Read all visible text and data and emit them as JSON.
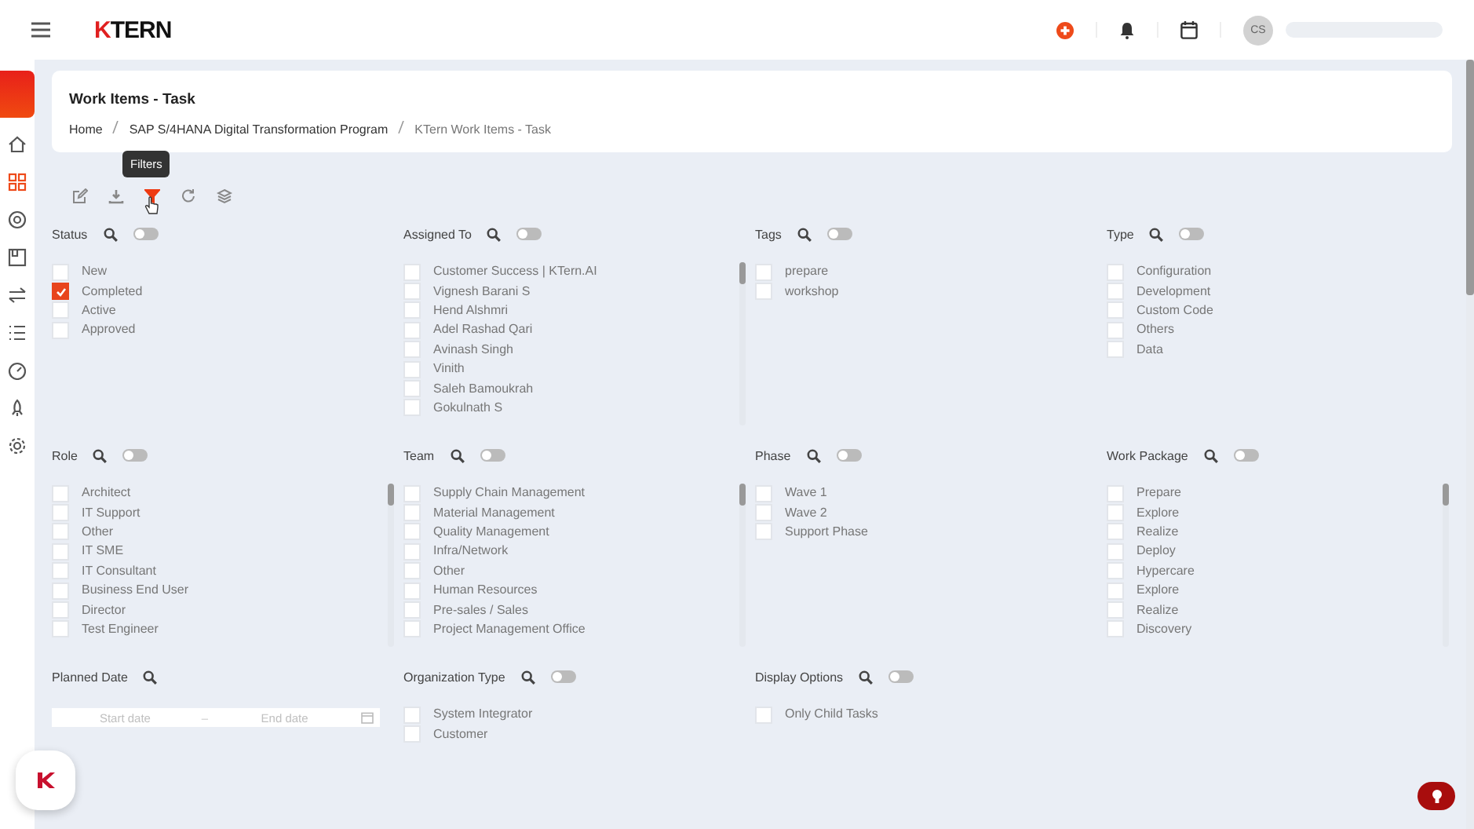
{
  "topbar": {
    "logo": "KTERN",
    "avatar": "CS"
  },
  "header": {
    "title": "Work Items - Task",
    "breadcrumb": [
      {
        "label": "Home",
        "current": false
      },
      {
        "label": "SAP S/4HANA Digital Transformation Program",
        "current": false
      },
      {
        "label": "KTern Work Items - Task",
        "current": true
      }
    ]
  },
  "toolbar": {
    "tooltip": "Filters",
    "tools": [
      {
        "kind": "edit",
        "selected": false
      },
      {
        "kind": "download",
        "selected": false
      },
      {
        "kind": "filter",
        "selected": true
      },
      {
        "kind": "refresh",
        "selected": false
      },
      {
        "kind": "layers",
        "selected": false
      }
    ]
  },
  "sidebar": {
    "items": [
      {
        "kind": "home",
        "selected": false
      },
      {
        "kind": "grid",
        "selected": true
      },
      {
        "kind": "pin",
        "selected": false
      },
      {
        "kind": "board",
        "selected": false
      },
      {
        "kind": "swap",
        "selected": false
      },
      {
        "kind": "list",
        "selected": false
      },
      {
        "kind": "gauge",
        "selected": false
      },
      {
        "kind": "rocket",
        "selected": false
      },
      {
        "kind": "gear",
        "selected": false
      }
    ]
  },
  "filters": [
    {
      "title": "Status",
      "kind": "checklist",
      "toggle": {
        "on": false
      },
      "options": [
        {
          "label": "New",
          "checked": false
        },
        {
          "label": "Completed",
          "checked": true
        },
        {
          "label": "Active",
          "checked": false
        },
        {
          "label": "Approved",
          "checked": false
        }
      ]
    },
    {
      "title": "Assigned To",
      "kind": "checklist",
      "toggle": {
        "on": false
      },
      "options": [
        {
          "label": "Customer Success | KTern.AI",
          "checked": false
        },
        {
          "label": "Vignesh Barani S",
          "checked": false
        },
        {
          "label": "Hend Alshmri",
          "checked": false
        },
        {
          "label": "Adel Rashad Qari",
          "checked": false
        },
        {
          "label": "Avinash Singh",
          "checked": false
        },
        {
          "label": "Vinith",
          "checked": false
        },
        {
          "label": "Saleh Bamoukrah",
          "checked": false
        },
        {
          "label": "Gokulnath S",
          "checked": false
        }
      ]
    },
    {
      "title": "Tags",
      "kind": "checklist",
      "toggle": {
        "on": false
      },
      "options": [
        {
          "label": "prepare",
          "checked": false
        },
        {
          "label": "workshop",
          "checked": false
        }
      ]
    },
    {
      "title": "Type",
      "kind": "checklist",
      "toggle": {
        "on": false
      },
      "options": [
        {
          "label": "Configuration",
          "checked": false
        },
        {
          "label": "Development",
          "checked": false
        },
        {
          "label": "Custom Code",
          "checked": false
        },
        {
          "label": "Others",
          "checked": false
        },
        {
          "label": "Data",
          "checked": false
        }
      ]
    },
    {
      "title": "Role",
      "kind": "checklist",
      "toggle": {
        "on": false
      },
      "options": [
        {
          "label": "Architect",
          "checked": false
        },
        {
          "label": "IT Support",
          "checked": false
        },
        {
          "label": "Other",
          "checked": false
        },
        {
          "label": "IT SME",
          "checked": false
        },
        {
          "label": "IT Consultant",
          "checked": false
        },
        {
          "label": "Business End User",
          "checked": false
        },
        {
          "label": "Director",
          "checked": false
        },
        {
          "label": "Test Engineer",
          "checked": false
        }
      ]
    },
    {
      "title": "Team",
      "kind": "checklist",
      "toggle": {
        "on": false
      },
      "options": [
        {
          "label": "Supply Chain Management",
          "checked": false
        },
        {
          "label": "Material Management",
          "checked": false
        },
        {
          "label": "Quality Management",
          "checked": false
        },
        {
          "label": "Infra/Network",
          "checked": false
        },
        {
          "label": "Other",
          "checked": false
        },
        {
          "label": "Human Resources",
          "checked": false
        },
        {
          "label": "Pre-sales / Sales",
          "checked": false
        },
        {
          "label": "Project Management Office",
          "checked": false
        }
      ]
    },
    {
      "title": "Phase",
      "kind": "checklist",
      "toggle": {
        "on": false
      },
      "options": [
        {
          "label": "Wave 1",
          "checked": false
        },
        {
          "label": "Wave 2",
          "checked": false
        },
        {
          "label": "Support Phase",
          "checked": false
        }
      ]
    },
    {
      "title": "Work Package",
      "kind": "checklist",
      "toggle": {
        "on": false
      },
      "options": [
        {
          "label": "Prepare",
          "checked": false
        },
        {
          "label": "Explore",
          "checked": false
        },
        {
          "label": "Realize",
          "checked": false
        },
        {
          "label": "Deploy",
          "checked": false
        },
        {
          "label": "Hypercare",
          "checked": false
        },
        {
          "label": "Explore",
          "checked": false
        },
        {
          "label": "Realize",
          "checked": false
        },
        {
          "label": "Discovery",
          "checked": false
        }
      ]
    },
    {
      "title": "Planned Date",
      "kind": "daterange",
      "start_placeholder": "Start date",
      "separator": "–",
      "end_placeholder": "End date"
    },
    {
      "title": "Organization Type",
      "kind": "checklist",
      "toggle": {
        "on": false
      },
      "options": [
        {
          "label": "System Integrator",
          "checked": false
        },
        {
          "label": "Customer",
          "checked": false
        }
      ]
    },
    {
      "title": "Display Options",
      "kind": "checklist",
      "toggle": {
        "on": false
      },
      "options": [
        {
          "label": "Only Child Tasks",
          "checked": false
        }
      ]
    }
  ]
}
